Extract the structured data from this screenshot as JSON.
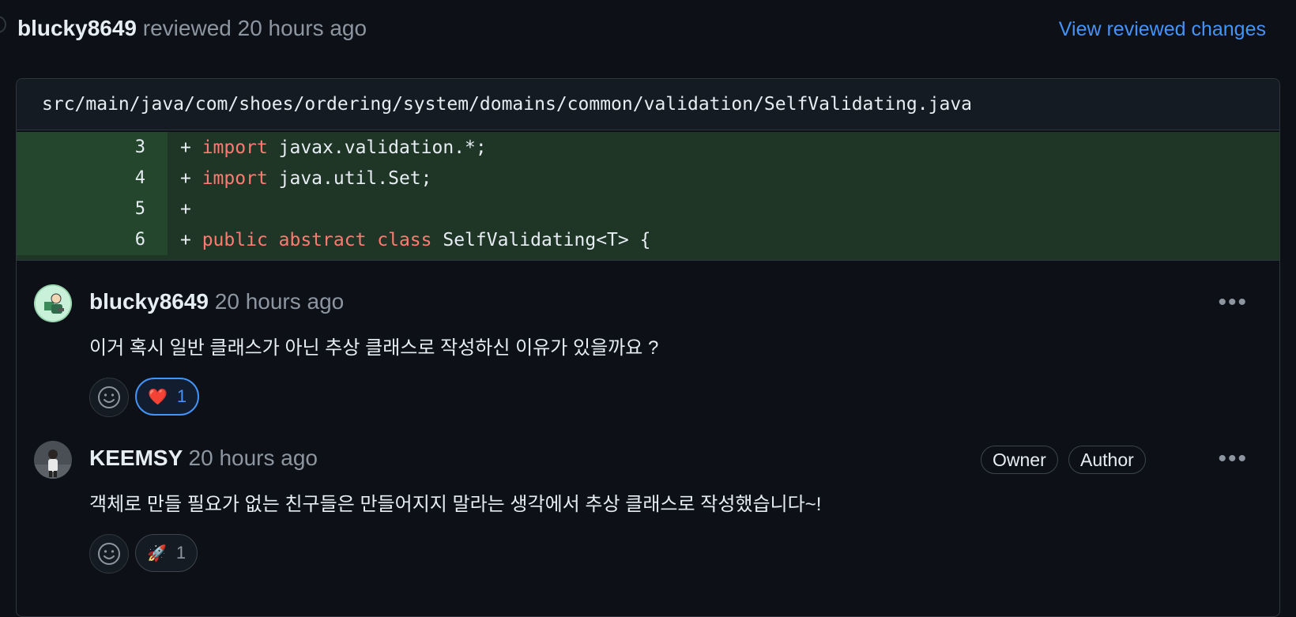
{
  "review": {
    "reviewer": "blucky8649",
    "action": "reviewed 20 hours ago",
    "view_changes_label": "View reviewed changes"
  },
  "file": {
    "path": "src/main/java/com/shoes/ordering/system/domains/common/validation/SelfValidating.java"
  },
  "diff": {
    "lines": [
      {
        "num": "3",
        "prefix": "+ ",
        "keyword": "import",
        "rest": " javax.validation.*;"
      },
      {
        "num": "4",
        "prefix": "+ ",
        "keyword": "import",
        "rest": " java.util.Set;"
      },
      {
        "num": "5",
        "prefix": "+",
        "keyword": "",
        "rest": ""
      },
      {
        "num": "6",
        "prefix": "+ ",
        "keyword": "public abstract class",
        "rest": " SelfValidating<T> {"
      }
    ]
  },
  "comments": [
    {
      "author": "blucky8649",
      "time": "20 hours ago",
      "text": "이거 혹시 일반 클래스가 아닌 추상 클래스로 작성하신 이유가 있을까요 ?",
      "reaction": {
        "emoji": "❤️",
        "count": "1",
        "active": true
      },
      "badges": []
    },
    {
      "author": "KEEMSY",
      "time": "20 hours ago",
      "text": "객체로 만들 필요가 없는 친구들은 만들어지지 말라는 생각에서 추상 클래스로 작성했습니다~!",
      "reaction": {
        "emoji": "🚀",
        "count": "1",
        "active": false
      },
      "badges": [
        "Owner",
        "Author"
      ]
    }
  ],
  "more_icon_glyph": "•••",
  "colors": {
    "background": "#0d1117",
    "link": "#4493f8",
    "keyword": "#ff7b72",
    "diff_added": "#1f3526"
  }
}
